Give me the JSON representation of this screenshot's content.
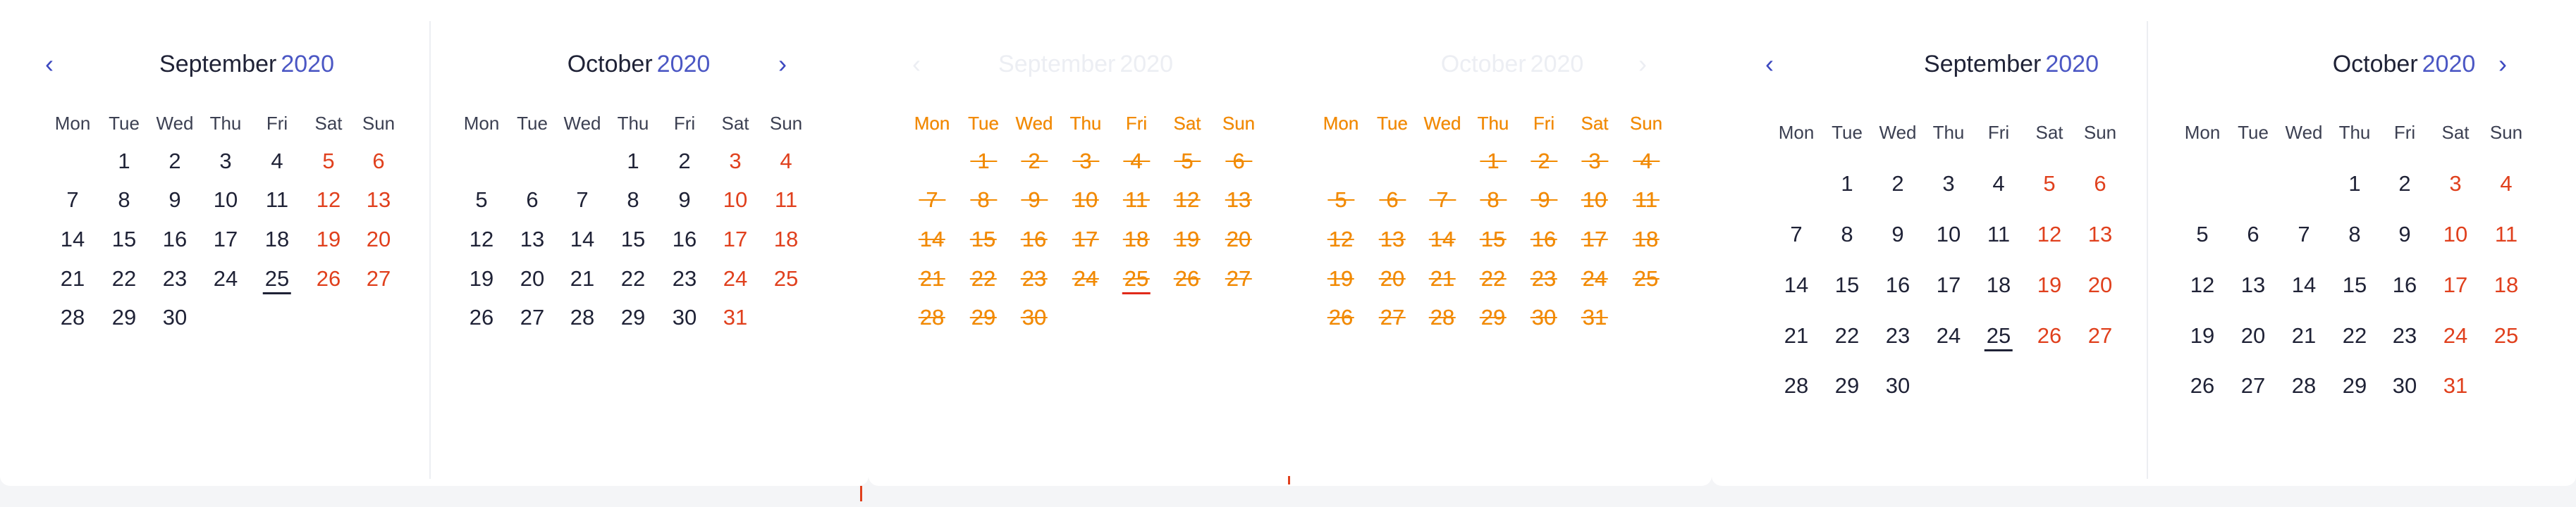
{
  "weekdays": [
    "Mon",
    "Tue",
    "Wed",
    "Thu",
    "Fri",
    "Sat",
    "Sun"
  ],
  "colors": {
    "accent": "#4b57c4",
    "weekend": "#e0401d",
    "text": "#1f2236",
    "ghost": "#f28a00"
  },
  "icons": {
    "prev": "chevron-left-icon",
    "next": "chevron-right-icon"
  },
  "calendars": [
    {
      "month": "September",
      "year": "2020",
      "nav": "prev",
      "today": 25,
      "days": [
        [
          null,
          1,
          2,
          3,
          4,
          5,
          6
        ],
        [
          7,
          8,
          9,
          10,
          11,
          12,
          13
        ],
        [
          14,
          15,
          16,
          17,
          18,
          19,
          20
        ],
        [
          21,
          22,
          23,
          24,
          25,
          26,
          27
        ],
        [
          28,
          29,
          30,
          null,
          null,
          null,
          null
        ]
      ]
    },
    {
      "month": "October",
      "year": "2020",
      "nav": "next",
      "today": null,
      "days": [
        [
          null,
          null,
          null,
          1,
          2,
          3,
          4
        ],
        [
          5,
          6,
          7,
          8,
          9,
          10,
          11
        ],
        [
          12,
          13,
          14,
          15,
          16,
          17,
          18
        ],
        [
          19,
          20,
          21,
          22,
          23,
          24,
          25
        ],
        [
          26,
          27,
          28,
          29,
          30,
          31,
          null
        ]
      ]
    },
    {
      "month": "September",
      "year": "2020",
      "nav": "prev",
      "today": 25,
      "ghost": true,
      "days": [
        [
          null,
          1,
          2,
          3,
          4,
          5,
          6
        ],
        [
          7,
          8,
          9,
          10,
          11,
          12,
          13
        ],
        [
          14,
          15,
          16,
          17,
          18,
          19,
          20
        ],
        [
          21,
          22,
          23,
          24,
          25,
          26,
          27
        ],
        [
          28,
          29,
          30,
          null,
          null,
          null,
          null
        ]
      ]
    },
    {
      "month": "October",
      "year": "2020",
      "nav": "next",
      "today": null,
      "ghost": true,
      "days": [
        [
          null,
          null,
          null,
          1,
          2,
          3,
          4
        ],
        [
          5,
          6,
          7,
          8,
          9,
          10,
          11
        ],
        [
          12,
          13,
          14,
          15,
          16,
          17,
          18
        ],
        [
          19,
          20,
          21,
          22,
          23,
          24,
          25
        ],
        [
          26,
          27,
          28,
          29,
          30,
          31,
          null
        ]
      ]
    },
    {
      "month": "September",
      "year": "2020",
      "nav": "prev",
      "today": 25,
      "days": [
        [
          null,
          1,
          2,
          3,
          4,
          5,
          6
        ],
        [
          7,
          8,
          9,
          10,
          11,
          12,
          13
        ],
        [
          14,
          15,
          16,
          17,
          18,
          19,
          20
        ],
        [
          21,
          22,
          23,
          24,
          25,
          26,
          27
        ],
        [
          28,
          29,
          30,
          null,
          null,
          null,
          null
        ]
      ]
    },
    {
      "month": "October",
      "year": "2020",
      "nav": "next",
      "today": null,
      "days": [
        [
          null,
          null,
          null,
          1,
          2,
          3,
          4
        ],
        [
          5,
          6,
          7,
          8,
          9,
          10,
          11
        ],
        [
          12,
          13,
          14,
          15,
          16,
          17,
          18
        ],
        [
          19,
          20,
          21,
          22,
          23,
          24,
          25
        ],
        [
          26,
          27,
          28,
          29,
          30,
          31,
          null
        ]
      ]
    }
  ]
}
